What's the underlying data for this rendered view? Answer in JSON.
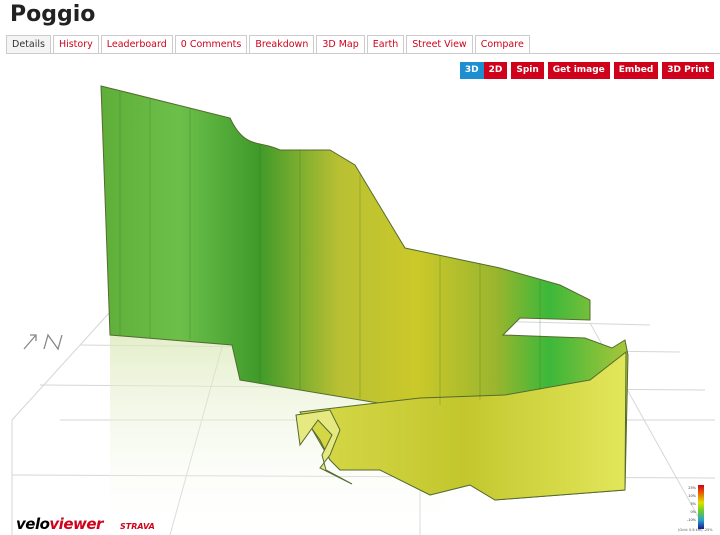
{
  "page": {
    "title": "Poggio"
  },
  "tabs": [
    {
      "label": "Details",
      "active": true
    },
    {
      "label": "History",
      "active": false
    },
    {
      "label": "Leaderboard",
      "active": false
    },
    {
      "label": "0 Comments",
      "active": false
    },
    {
      "label": "Breakdown",
      "active": false
    },
    {
      "label": "3D Map",
      "active": false
    },
    {
      "label": "Earth",
      "active": false
    },
    {
      "label": "Street View",
      "active": false
    },
    {
      "label": "Compare",
      "active": false
    }
  ],
  "toolbar": {
    "mode_3d": "3D",
    "mode_2d": "2D",
    "spin": "Spin",
    "get_image": "Get image",
    "embed": "Embed",
    "print_3d": "3D Print"
  },
  "branding": {
    "logo_part1": "velo",
    "logo_part2": "viewer",
    "partner": "STRAVA"
  },
  "legend": {
    "labels": [
      "25%",
      "10%",
      "5%",
      "0%",
      "-10%",
      "-25%"
    ],
    "grid_note": "(Grid: 0.6 km) -25%"
  },
  "colors": {
    "accent": "#d0021b",
    "active_mode": "#1d8fd1"
  }
}
